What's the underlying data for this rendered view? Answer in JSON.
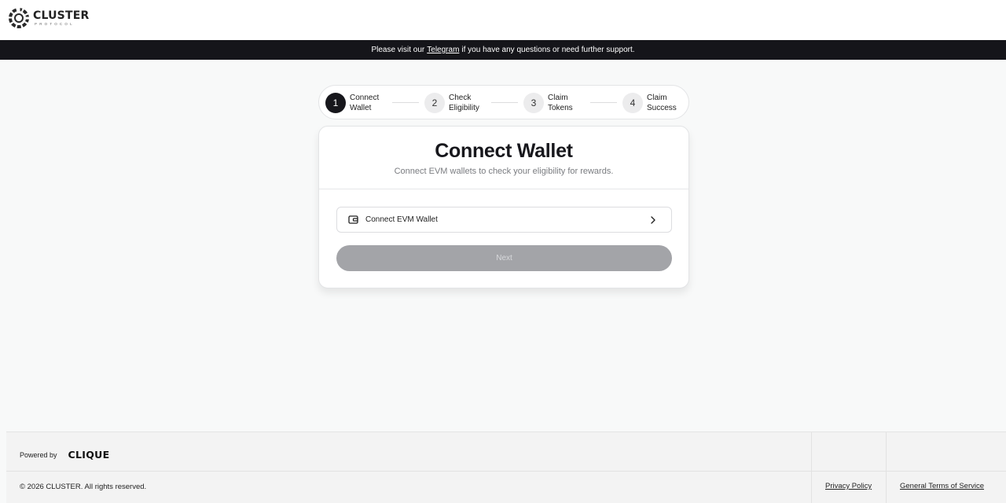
{
  "header": {
    "logo_name": "CLUSTER",
    "logo_sub": "PROTOCOL"
  },
  "banner": {
    "prefix": "Please visit our",
    "link": "Telegram",
    "suffix": "if you have any questions or need further support."
  },
  "stepper": {
    "steps": [
      {
        "num": "1",
        "line1": "Connect",
        "line2": "Wallet",
        "active": true
      },
      {
        "num": "2",
        "line1": "Check",
        "line2": "Eligibility",
        "active": false
      },
      {
        "num": "3",
        "line1": "Claim",
        "line2": "Tokens",
        "active": false
      },
      {
        "num": "4",
        "line1": "Claim",
        "line2": "Success",
        "active": false
      }
    ]
  },
  "card": {
    "title": "Connect Wallet",
    "subtitle": "Connect EVM wallets to check your eligibility for rewards.",
    "wallet_button": "Connect EVM Wallet",
    "next_button": "Next"
  },
  "footer": {
    "powered_by": "Powered by",
    "powered_brand": "CLIQUE",
    "copyright": "© 2026 CLUSTER. All rights reserved.",
    "privacy": "Privacy Policy",
    "terms": "General Terms of Service"
  },
  "colors": {
    "dark": "#15151a",
    "background": "#f8f9f9",
    "disabled_button": "#a3a4a8"
  }
}
